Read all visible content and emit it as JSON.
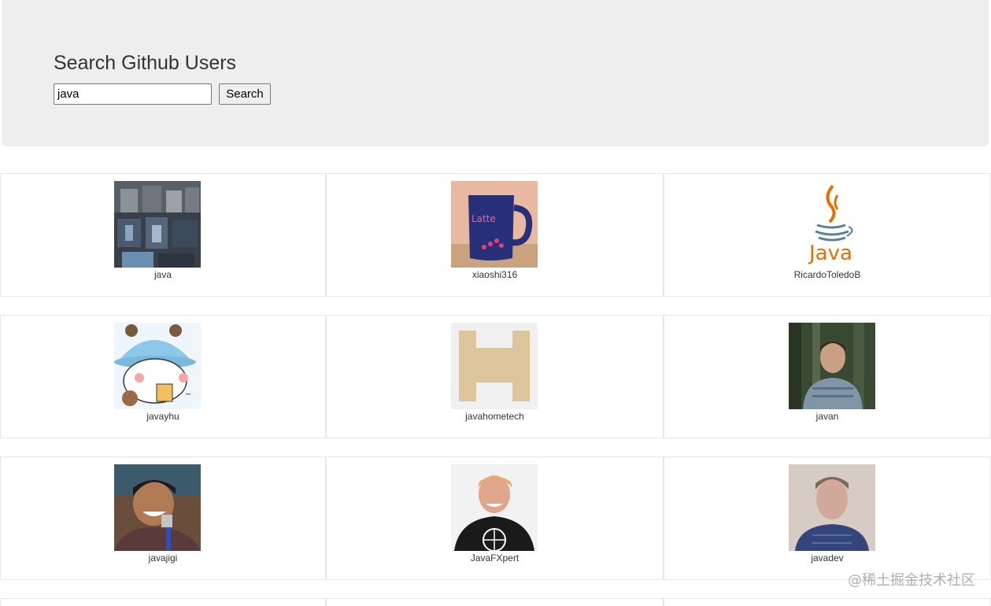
{
  "header": {
    "title": "Search Github Users",
    "search_value": "java",
    "search_button": "Search"
  },
  "users": [
    {
      "login": "java",
      "avatar": "letterpress-type-icon"
    },
    {
      "login": "xiaoshi316",
      "avatar": "latte-mug-icon"
    },
    {
      "login": "RicardoToledoB",
      "avatar": "java-logo-icon"
    },
    {
      "login": "javayhu",
      "avatar": "cartoon-bear-icon"
    },
    {
      "login": "javahometech",
      "avatar": "identicon-icon"
    },
    {
      "login": "javan",
      "avatar": "person-photo-icon"
    },
    {
      "login": "javajigi",
      "avatar": "person-photo-icon"
    },
    {
      "login": "JavaFXpert",
      "avatar": "person-photo-icon"
    },
    {
      "login": "javadev",
      "avatar": "person-photo-icon"
    }
  ],
  "watermark": "@稀土掘金技术社区",
  "colors": {
    "jumbotron": "#eeeeee",
    "java_red": "#e76f00",
    "java_blue": "#5382a1",
    "identicon": "#dcc59a"
  }
}
